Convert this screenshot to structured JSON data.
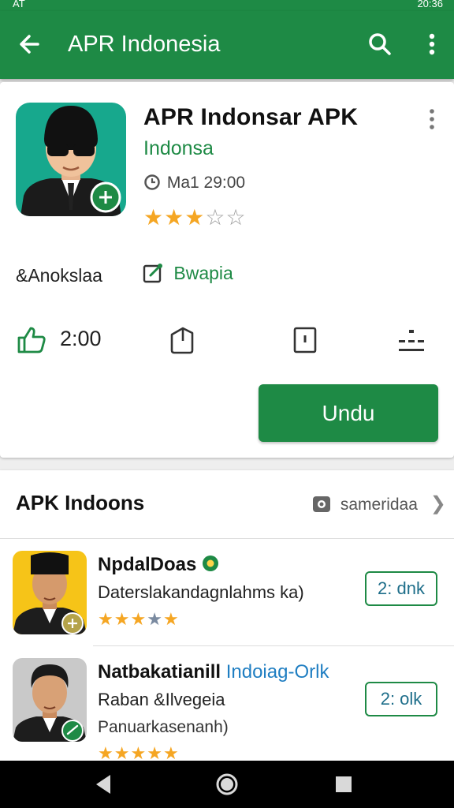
{
  "status_bar": {
    "left_text": "AT",
    "right_text": "20:36"
  },
  "app_bar": {
    "title": "APR Indonesia"
  },
  "app": {
    "title": "APR Indonsar APK",
    "developer": "Indonsa",
    "meta": "Ma1 29:00",
    "rating": 3,
    "rating_max": 5,
    "category": "&Anokslaa",
    "edit_label": "Bwapia",
    "likes": "2:00",
    "download_label": "Undu"
  },
  "section": {
    "title": "APK Indoons",
    "see_more": "sameridaa",
    "items": [
      {
        "name": "NpdalDoas",
        "developer": "",
        "subtitle": "Daterslakandagnlahms ka)",
        "subtitle2": "",
        "rating": 4,
        "size_label": "2: dnk"
      },
      {
        "name": "Natbakatianill",
        "developer": "Indoiag-Orlk",
        "subtitle": "Raban &Ilvegeia",
        "subtitle2": "Panuarkasenanh)",
        "rating": 5,
        "size_label": "2: olk"
      }
    ]
  },
  "colors": {
    "primary": "#1e8a45",
    "star": "#f5a623",
    "link": "#1f7ec2"
  },
  "icons": [
    "back-arrow-icon",
    "search-icon",
    "more-vert-icon",
    "clock-icon",
    "edit-icon",
    "thumb-up-icon",
    "share-icon",
    "bookmark-icon",
    "menu-icon",
    "camera-icon",
    "chevron-right-icon",
    "verified-badge-icon"
  ]
}
